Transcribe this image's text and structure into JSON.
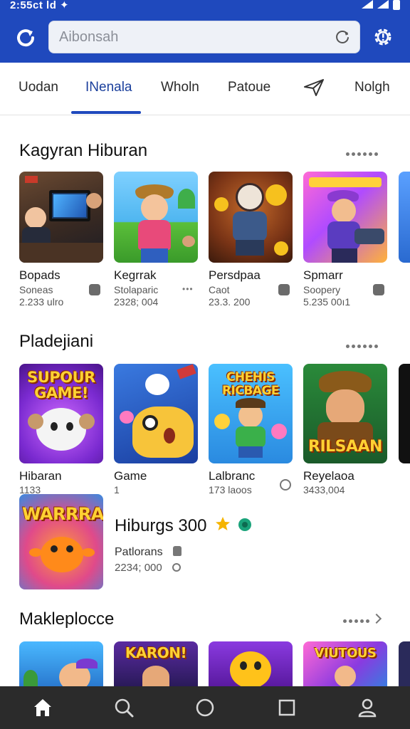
{
  "status_bar": {
    "time": "2:55ct ld ✦"
  },
  "search": {
    "placeholder": "Aibonsah"
  },
  "tabs": [
    {
      "label": "Uodan",
      "active": false
    },
    {
      "label": "INenala",
      "active": true
    },
    {
      "label": "Wholn",
      "active": false
    },
    {
      "label": "Patoue",
      "active": false
    },
    {
      "label": "",
      "icon": "paper-plane-icon",
      "active": false
    },
    {
      "label": "Nolgh",
      "active": false
    }
  ],
  "sections": [
    {
      "title": "Kagyran Hiburan",
      "items": [
        {
          "name": "Bopads",
          "sub": "Soneas",
          "meta": "2.233 ulro"
        },
        {
          "name": "Kegrrak",
          "sub": "Stolaparic",
          "meta": "2328; 004"
        },
        {
          "name": "Persdpaa",
          "sub": "Caot",
          "meta": "23.3. 200"
        },
        {
          "name": "Spmarr",
          "sub": "Soopery",
          "meta": "5.235 00ı1"
        }
      ]
    },
    {
      "title": "Pladejiani",
      "items": [
        {
          "name": "Hibaran",
          "sub": "",
          "meta": "1133",
          "art_text": "SUPOUR GAME!"
        },
        {
          "name": "Game",
          "sub": "",
          "meta": "1"
        },
        {
          "name": "Lalbranc",
          "sub": "",
          "meta": "173 laoos",
          "art_text": "CHEHIS RICBAGE"
        },
        {
          "name": "Reyelaoa",
          "sub": "",
          "meta": "3433,004",
          "art_text": "RILSAAN"
        }
      ]
    },
    {
      "title": "Makleplocce",
      "items": [
        {
          "name": "",
          "art_text": ""
        },
        {
          "name": "",
          "art_text": "KARON!"
        },
        {
          "name": "",
          "art_text": ""
        },
        {
          "name": "",
          "art_text": "VIUTOUS"
        }
      ]
    }
  ],
  "featured": {
    "art_text": "WARRRA",
    "title": "Hiburgs 300",
    "sub": "Patlorans",
    "meta": "2234; 000"
  },
  "colors": {
    "brand": "#1f49bd",
    "nav_bg": "#2b2b2b",
    "star": "#f5b400",
    "verified": "#1aa37a"
  }
}
